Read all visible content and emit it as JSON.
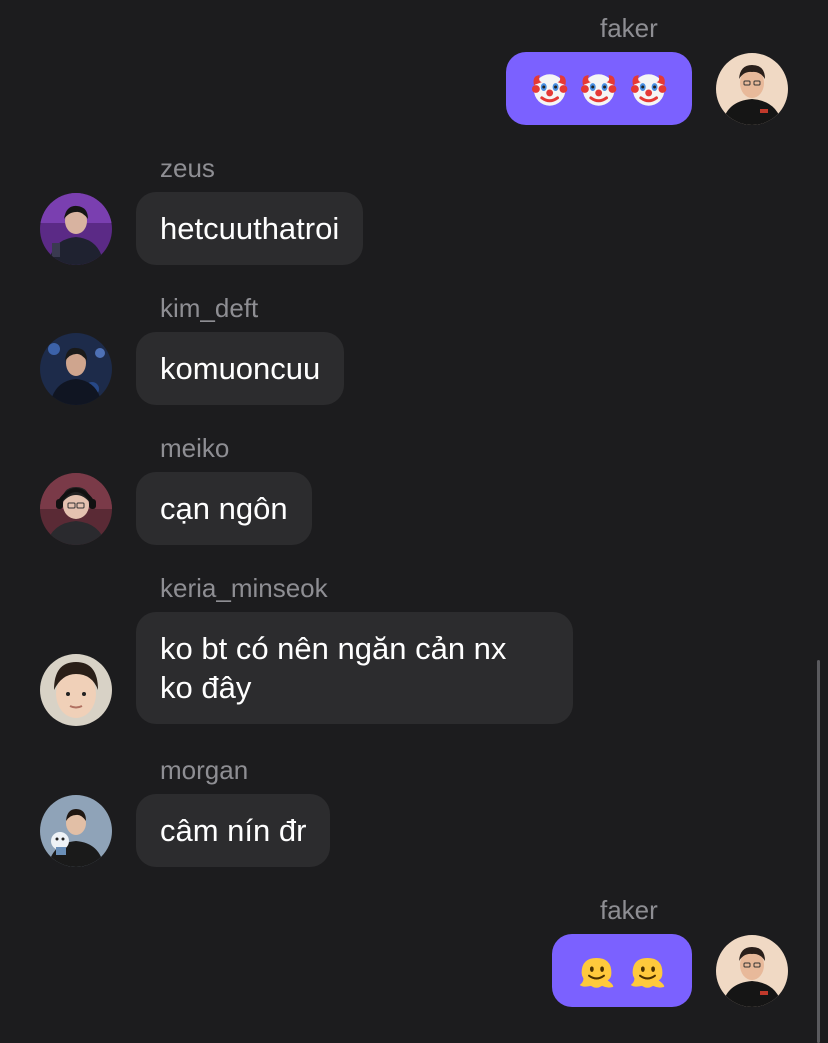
{
  "messages": [
    {
      "user": "faker",
      "text": "",
      "emoji": [
        "clown-face",
        "clown-face",
        "clown-face"
      ],
      "direction": "outgoing"
    },
    {
      "user": "zeus",
      "text": "hetcuuthatroi",
      "direction": "incoming"
    },
    {
      "user": "kim_deft",
      "text": "komuoncuu",
      "direction": "incoming"
    },
    {
      "user": "meiko",
      "text": "cạn ngôn",
      "direction": "incoming"
    },
    {
      "user": "keria_minseok",
      "line1": "ko bt có nên ngăn cản nx",
      "line2": "ko đây",
      "direction": "incoming"
    },
    {
      "user": "morgan",
      "text": "câm nín đr",
      "direction": "incoming"
    },
    {
      "user": "faker",
      "text": "",
      "emoji": [
        "melting-face",
        "melting-face"
      ],
      "direction": "outgoing"
    }
  ],
  "colors": {
    "background": "#1c1c1e",
    "incoming_bubble": "#2c2c2e",
    "outgoing_bubble": "#7b61ff",
    "username": "#8e8e93",
    "message_text": "#ffffff"
  }
}
